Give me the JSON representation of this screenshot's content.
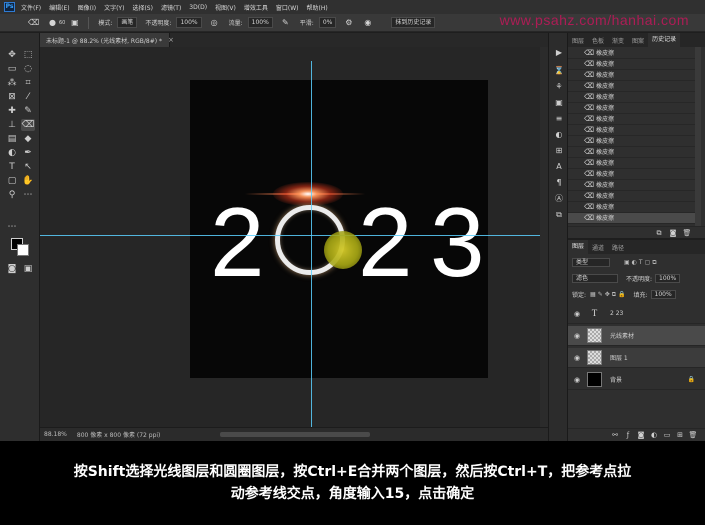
{
  "menubar": {
    "logo": "Ps",
    "items": [
      "文件(F)",
      "编辑(E)",
      "图像(I)",
      "文字(Y)",
      "选择(S)",
      "滤镜(T)",
      "3D(D)",
      "视图(V)",
      "增效工具",
      "窗口(W)",
      "帮助(H)"
    ]
  },
  "options": {
    "brush_size": "60",
    "mode_label": "模式:",
    "mode_value": "画笔",
    "opacity_label": "不透明度:",
    "opacity_value": "100%",
    "flow_label": "流量:",
    "flow_value": "100%",
    "smooth_label": "平滑:",
    "smooth_value": "0%",
    "erase_history": "抹到历史记录"
  },
  "watermark": "www.psahz.com/hanhai.com",
  "document": {
    "tab_title": "未标题-1 @ 88.2% (光线素材, RGB/8#) *",
    "digits": [
      "2",
      "2",
      "3"
    ],
    "zoom": "88.18%",
    "size_info": "800 像素 x 800 像素 (72 ppi)"
  },
  "history": {
    "tabs": [
      "图层",
      "色板",
      "渐变",
      "图案",
      "历史记录"
    ],
    "items": [
      "橡皮擦",
      "橡皮擦",
      "橡皮擦",
      "橡皮擦",
      "橡皮擦",
      "橡皮擦",
      "橡皮擦",
      "橡皮擦",
      "橡皮擦",
      "橡皮擦",
      "橡皮擦",
      "橡皮擦",
      "橡皮擦",
      "橡皮擦",
      "橡皮擦",
      "橡皮擦"
    ]
  },
  "layers": {
    "tabs": [
      "图层",
      "通道",
      "路径"
    ],
    "kind_filter": "类型",
    "blend_mode": "滤色",
    "opacity_label": "不透明度:",
    "opacity_value": "100%",
    "lock_label": "锁定:",
    "fill_label": "填充:",
    "fill_value": "100%",
    "list": [
      {
        "name": "2 23",
        "thumb": "text",
        "thumb_glyph": "T",
        "selected": false
      },
      {
        "name": "光线素材",
        "thumb": "checker",
        "selected": true
      },
      {
        "name": "图层 1",
        "thumb": "checker",
        "selected": false
      },
      {
        "name": "背景",
        "thumb": "black",
        "selected": false,
        "locked": true
      }
    ]
  },
  "caption": {
    "line1": "按Shift选择光线图层和圆圈图层，按Ctrl+E合并两个图层，然后按Ctrl+T，把参考点拉",
    "line2": "动参考线交点，角度输入15，点击确定"
  },
  "colors": {
    "foreground": "#000000",
    "background": "#ffffff",
    "guide": "#5ad0ff",
    "reference_point": "#c8c020",
    "watermark": "#c2185b"
  }
}
